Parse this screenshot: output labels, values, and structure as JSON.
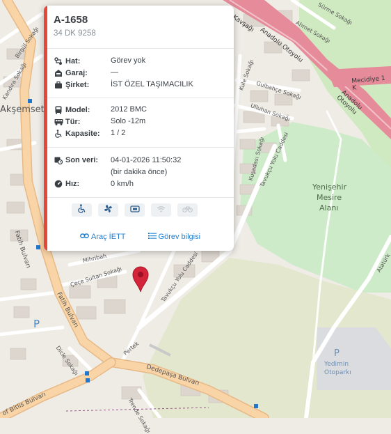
{
  "vehicle": {
    "id": "A-1658",
    "plate": "34 DK 9258"
  },
  "route_info": [
    {
      "icon": "route-icon",
      "label": "Hat:",
      "value": "Görev yok"
    },
    {
      "icon": "garage-icon",
      "label": "Garaj:",
      "value": "—"
    },
    {
      "icon": "briefcase-icon",
      "label": "Şirket:",
      "value": "İST ÖZEL TAŞIMACILIK"
    }
  ],
  "bus_info": [
    {
      "icon": "bus-icon",
      "label": "Model:",
      "value": "2012 BMC"
    },
    {
      "icon": "bus-side-icon",
      "label": "Tür:",
      "value": "Solo -12m"
    },
    {
      "icon": "wheelchair-icon",
      "label": "Kapasite:",
      "value": "1 / 2"
    }
  ],
  "status": {
    "last_data_label": "Son veri:",
    "last_data_value": "04-01-2026 11:50:32",
    "last_data_relative": "(bir dakika önce)",
    "speed_label": "Hız:",
    "speed_value": "0 km/h"
  },
  "features": [
    {
      "icon": "wheelchair-icon",
      "active": true
    },
    {
      "icon": "air-conditioning-icon",
      "active": true
    },
    {
      "icon": "card-reader-icon",
      "active": true
    },
    {
      "icon": "wifi-icon",
      "active": false
    },
    {
      "icon": "bicycle-icon",
      "active": false
    }
  ],
  "links": {
    "vehicle_iett": "Araç İETT",
    "task_info": "Görev bilgisi"
  },
  "map_labels": {
    "akşemsettin": "Akşemset",
    "park_name_1": "Yenişehir",
    "park_name_2": "Mesire",
    "park_name_3": "Alanı",
    "fatih_bulvari_1": "Fatih Bulvarı",
    "fatih_bulvari_2": "Fatih Bulvarı",
    "dedepasa": "Dedepaşa Bulvarı",
    "bitlis": "of Bitlis Bulvarı",
    "anadolu_1": "Anadolu Otoyolu",
    "anadolu_2": "Anadolu Otoyolu",
    "mecidiye": "Mecidiye 1 K",
    "kavsagi": "Kavşağı",
    "surme": "Sürme Sokağı",
    "ahmet": "Ahmet Sokağı",
    "gulbahce": "Gulbahçe Sokağı",
    "ulluhan": "Ulluhan Sokağı",
    "kule": "Kule Sokağı",
    "kusadasi": "Kuşadası Sokağı",
    "tavukcu_1": "Tavukçu Yolu Caddesi",
    "tavukcu_2": "Tavukçu Yolu Caddesi",
    "ataturk": "Atatürk",
    "kandira": "Kandıra Sokağı",
    "birgul": "Birgül Sokağı",
    "mihribah": "Mihribah",
    "cece": "Çeçe Sultan Sokağı",
    "dicle": "Dicle Sokağı",
    "trende": "Trende Sokağı",
    "pertek": "Pertek",
    "yedimin_1": "Yedimin",
    "yedimin_2": "Otoparkı",
    "parking_p": "P"
  }
}
